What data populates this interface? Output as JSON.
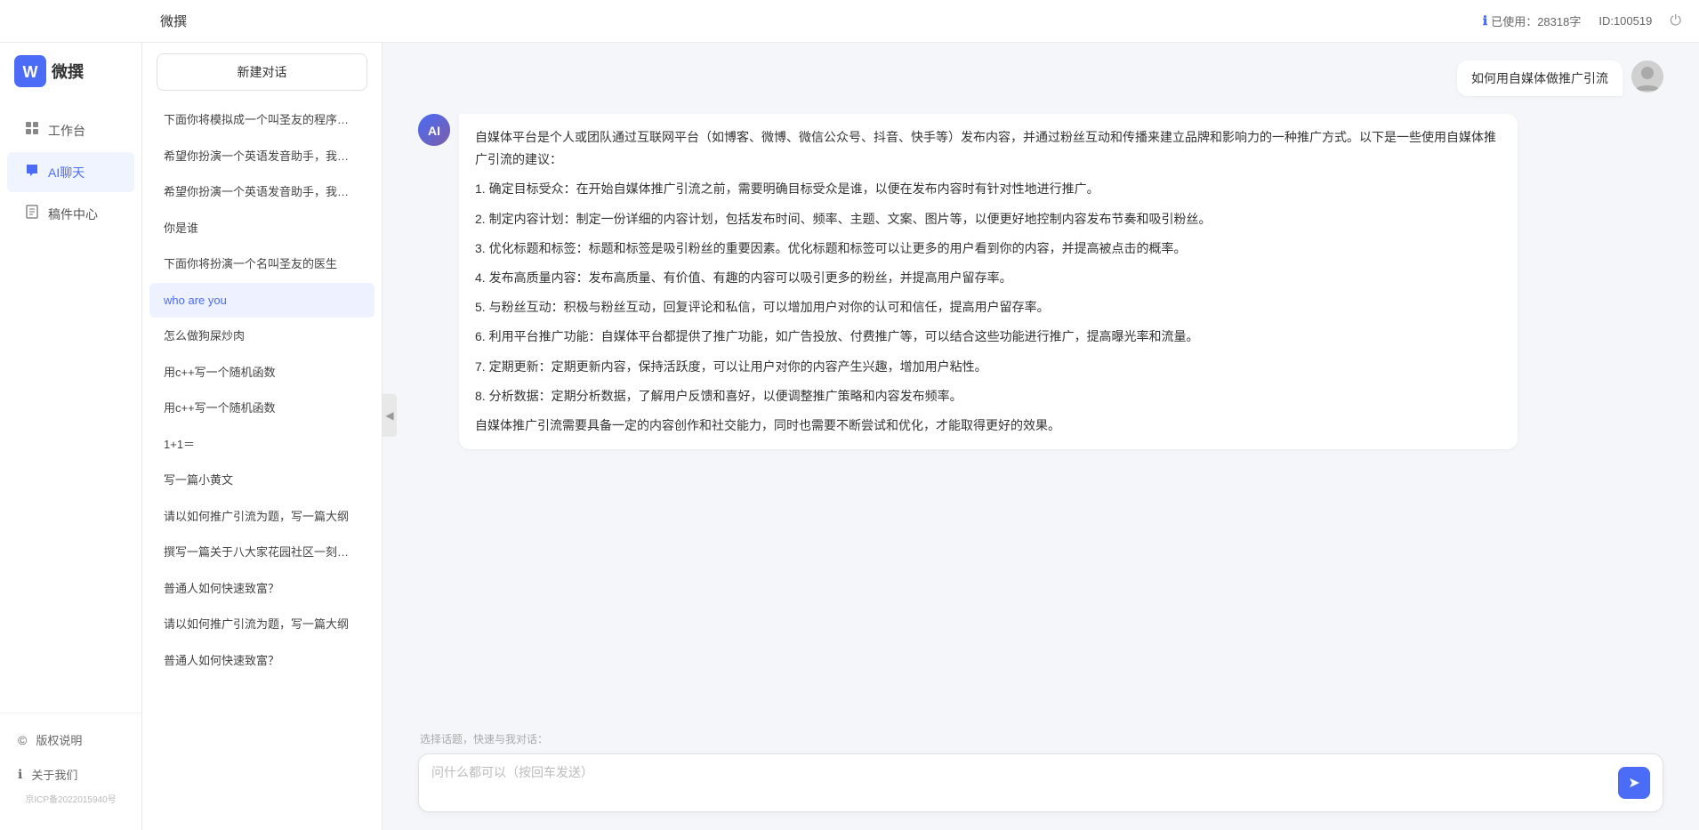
{
  "topbar": {
    "title": "微撰",
    "usage_label": "已使用：28318字",
    "id_label": "ID:100519",
    "usage_icon": "info-icon",
    "logout_icon": "power-icon"
  },
  "sidebar": {
    "logo_text": "微撰",
    "nav_items": [
      {
        "id": "workspace",
        "label": "工作台",
        "icon": "⊞"
      },
      {
        "id": "ai-chat",
        "label": "AI聊天",
        "icon": "💬",
        "active": true
      },
      {
        "id": "drafts",
        "label": "稿件中心",
        "icon": "📄"
      }
    ],
    "footer_items": [
      {
        "id": "copyright",
        "label": "版权说明",
        "icon": "©"
      },
      {
        "id": "about",
        "label": "关于我们",
        "icon": "ℹ"
      }
    ],
    "icp": "京ICP备2022015940号"
  },
  "history": {
    "new_chat_label": "新建对话",
    "items": [
      {
        "id": 1,
        "text": "下面你将模拟成一个叫圣友的程序员，我说...",
        "active": false
      },
      {
        "id": 2,
        "text": "希望你扮演一个英语发音助手，我提供给你...",
        "active": false
      },
      {
        "id": 3,
        "text": "希望你扮演一个英语发音助手，我提供给你...",
        "active": false
      },
      {
        "id": 4,
        "text": "你是谁",
        "active": false
      },
      {
        "id": 5,
        "text": "下面你将扮演一个名叫圣友的医生",
        "active": false
      },
      {
        "id": 6,
        "text": "who are you",
        "active": true
      },
      {
        "id": 7,
        "text": "怎么做狗屎炒肉",
        "active": false
      },
      {
        "id": 8,
        "text": "用c++写一个随机函数",
        "active": false
      },
      {
        "id": 9,
        "text": "用c++写一个随机函数",
        "active": false
      },
      {
        "id": 10,
        "text": "1+1＝",
        "active": false
      },
      {
        "id": 11,
        "text": "写一篇小黄文",
        "active": false
      },
      {
        "id": 12,
        "text": "请以如何推广引流为题，写一篇大纲",
        "active": false
      },
      {
        "id": 13,
        "text": "撰写一篇关于八大家花园社区一刻钟便民生...",
        "active": false
      },
      {
        "id": 14,
        "text": "普通人如何快速致富？",
        "active": false
      },
      {
        "id": 15,
        "text": "请以如何推广引流为题，写一篇大纲",
        "active": false
      },
      {
        "id": 16,
        "text": "普通人如何快速致富？",
        "active": false
      }
    ]
  },
  "chat": {
    "user_message": "如何用自媒体做推广引流",
    "ai_response": {
      "paragraphs": [
        "自媒体平台是个人或团队通过互联网平台（如博客、微博、微信公众号、抖音、快手等）发布内容，并通过粉丝互动和传播来建立品牌和影响力的一种推广方式。以下是一些使用自媒体推广引流的建议：",
        "1. 确定目标受众：在开始自媒体推广引流之前，需要明确目标受众是谁，以便在发布内容时有针对性地进行推广。",
        "2. 制定内容计划：制定一份详细的内容计划，包括发布时间、频率、主题、文案、图片等，以便更好地控制内容发布节奏和吸引粉丝。",
        "3. 优化标题和标签：标题和标签是吸引粉丝的重要因素。优化标题和标签可以让更多的用户看到你的内容，并提高被点击的概率。",
        "4. 发布高质量内容：发布高质量、有价值、有趣的内容可以吸引更多的粉丝，并提高用户留存率。",
        "5. 与粉丝互动：积极与粉丝互动，回复评论和私信，可以增加用户对你的认可和信任，提高用户留存率。",
        "6. 利用平台推广功能：自媒体平台都提供了推广功能，如广告投放、付费推广等，可以结合这些功能进行推广，提高曝光率和流量。",
        "7. 定期更新：定期更新内容，保持活跃度，可以让用户对你的内容产生兴趣，增加用户粘性。",
        "8. 分析数据：定期分析数据，了解用户反馈和喜好，以便调整推广策略和内容发布频率。",
        "自媒体推广引流需要具备一定的内容创作和社交能力，同时也需要不断尝试和优化，才能取得更好的效果。"
      ]
    },
    "input_placeholder": "问什么都可以（按回车发送）",
    "quick_topics_label": "选择话题，快速与我对话："
  }
}
